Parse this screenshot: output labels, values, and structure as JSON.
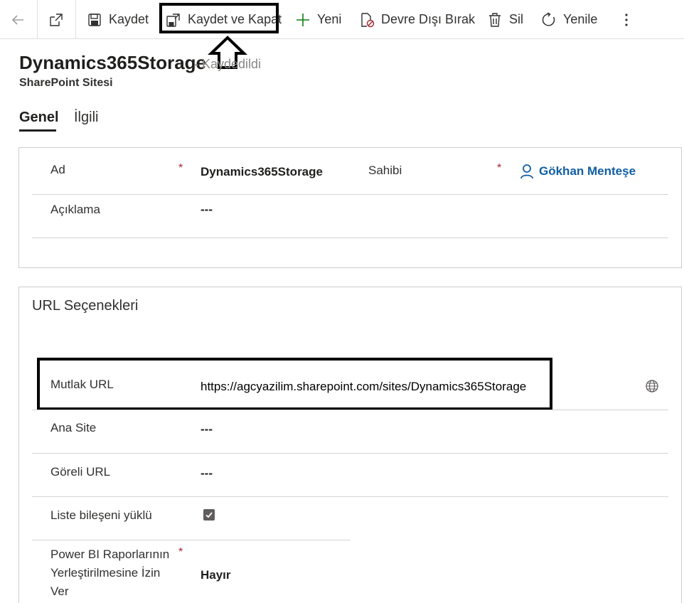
{
  "toolbar": {
    "save_label": "Kaydet",
    "save_close_label": "Kaydet ve Kapat",
    "new_label": "Yeni",
    "deactivate_label": "Devre Dışı Bırak",
    "delete_label": "Sil",
    "refresh_label": "Yenile"
  },
  "header": {
    "title": "Dynamics365Storage",
    "status": "- Kaydedildi",
    "entity": "SharePoint Sitesi"
  },
  "tabs": [
    {
      "label": "Genel",
      "active": true
    },
    {
      "label": "İlgili",
      "active": false
    }
  ],
  "general": {
    "name_label": "Ad",
    "name_value": "Dynamics365Storage",
    "owner_label": "Sahibi",
    "owner_value": "Gökhan Menteşe",
    "description_label": "Açıklama",
    "description_value": "---",
    "required_mark": "*"
  },
  "url_options": {
    "section_title": "URL Seçenekleri",
    "absolute_url_label": "Mutlak URL",
    "absolute_url_value": "https://agcyazilim.sharepoint.com/sites/Dynamics365Storage",
    "parent_site_label": "Ana Site",
    "parent_site_value": "---",
    "relative_url_label": "Göreli URL",
    "relative_url_value": "---",
    "list_component_label": "Liste bileşeni yüklü",
    "list_component_checked": true,
    "powerbi_label_line1": "Power BI Raporlarının",
    "powerbi_label_line2": "Yerleştirilmesine İzin",
    "powerbi_label_line3": "Ver",
    "powerbi_value": "Hayır"
  },
  "colors": {
    "accent_link": "#115ea3",
    "required": "#a4262c",
    "new_icon": "#107c10"
  }
}
